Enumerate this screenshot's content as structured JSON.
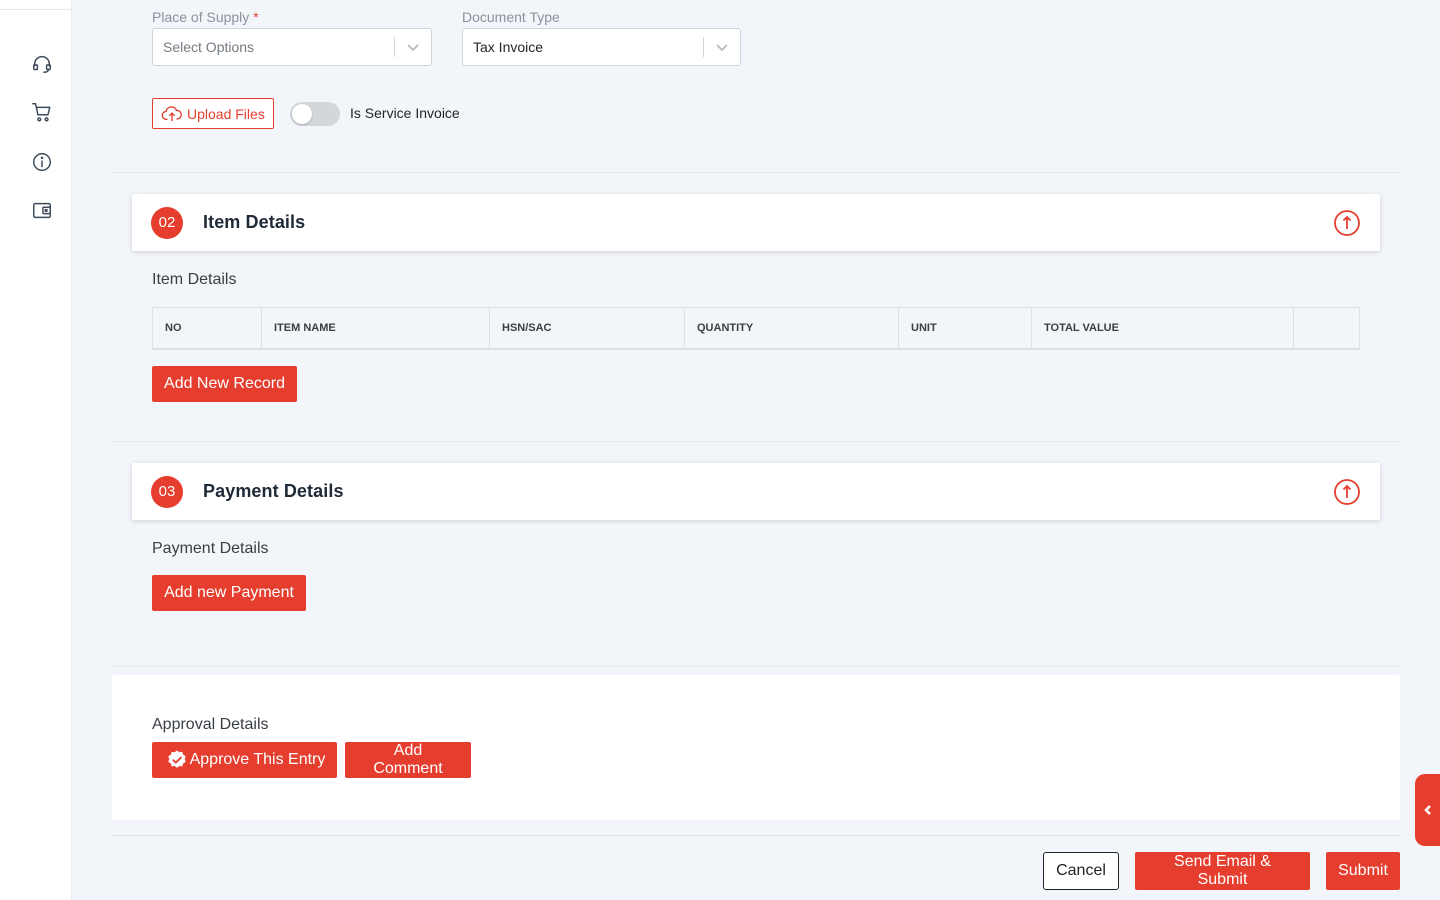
{
  "form": {
    "place_of_supply_label": "Place of Supply",
    "place_of_supply_required": "*",
    "place_of_supply_placeholder": "Select Options",
    "document_type_label": "Document Type",
    "document_type_value": "Tax Invoice",
    "upload_label": "Upload Files",
    "service_invoice_label": "Is Service Invoice",
    "service_invoice_on": false
  },
  "items_section": {
    "step": "02",
    "title": "Item Details",
    "subtitle": "Item Details",
    "columns": [
      "NO",
      "ITEM NAME",
      "HSN/SAC",
      "QUANTITY",
      "UNIT",
      "TOTAL VALUE",
      ""
    ],
    "add_button": "Add New Record"
  },
  "payment_section": {
    "step": "03",
    "title": "Payment Details",
    "subtitle": "Payment Details",
    "add_button": "Add new Payment"
  },
  "approval": {
    "title": "Approval Details",
    "approve_button": "Approve This Entry",
    "comment_button": "Add Comment"
  },
  "footer": {
    "cancel": "Cancel",
    "send_email_submit": "Send Email & Submit",
    "submit": "Submit"
  },
  "sidebar": {
    "icons": [
      "headset-icon",
      "cart-icon",
      "info-icon",
      "wallet-icon"
    ]
  },
  "colors": {
    "accent": "#e53e2f",
    "background": "#f2f5f9"
  }
}
